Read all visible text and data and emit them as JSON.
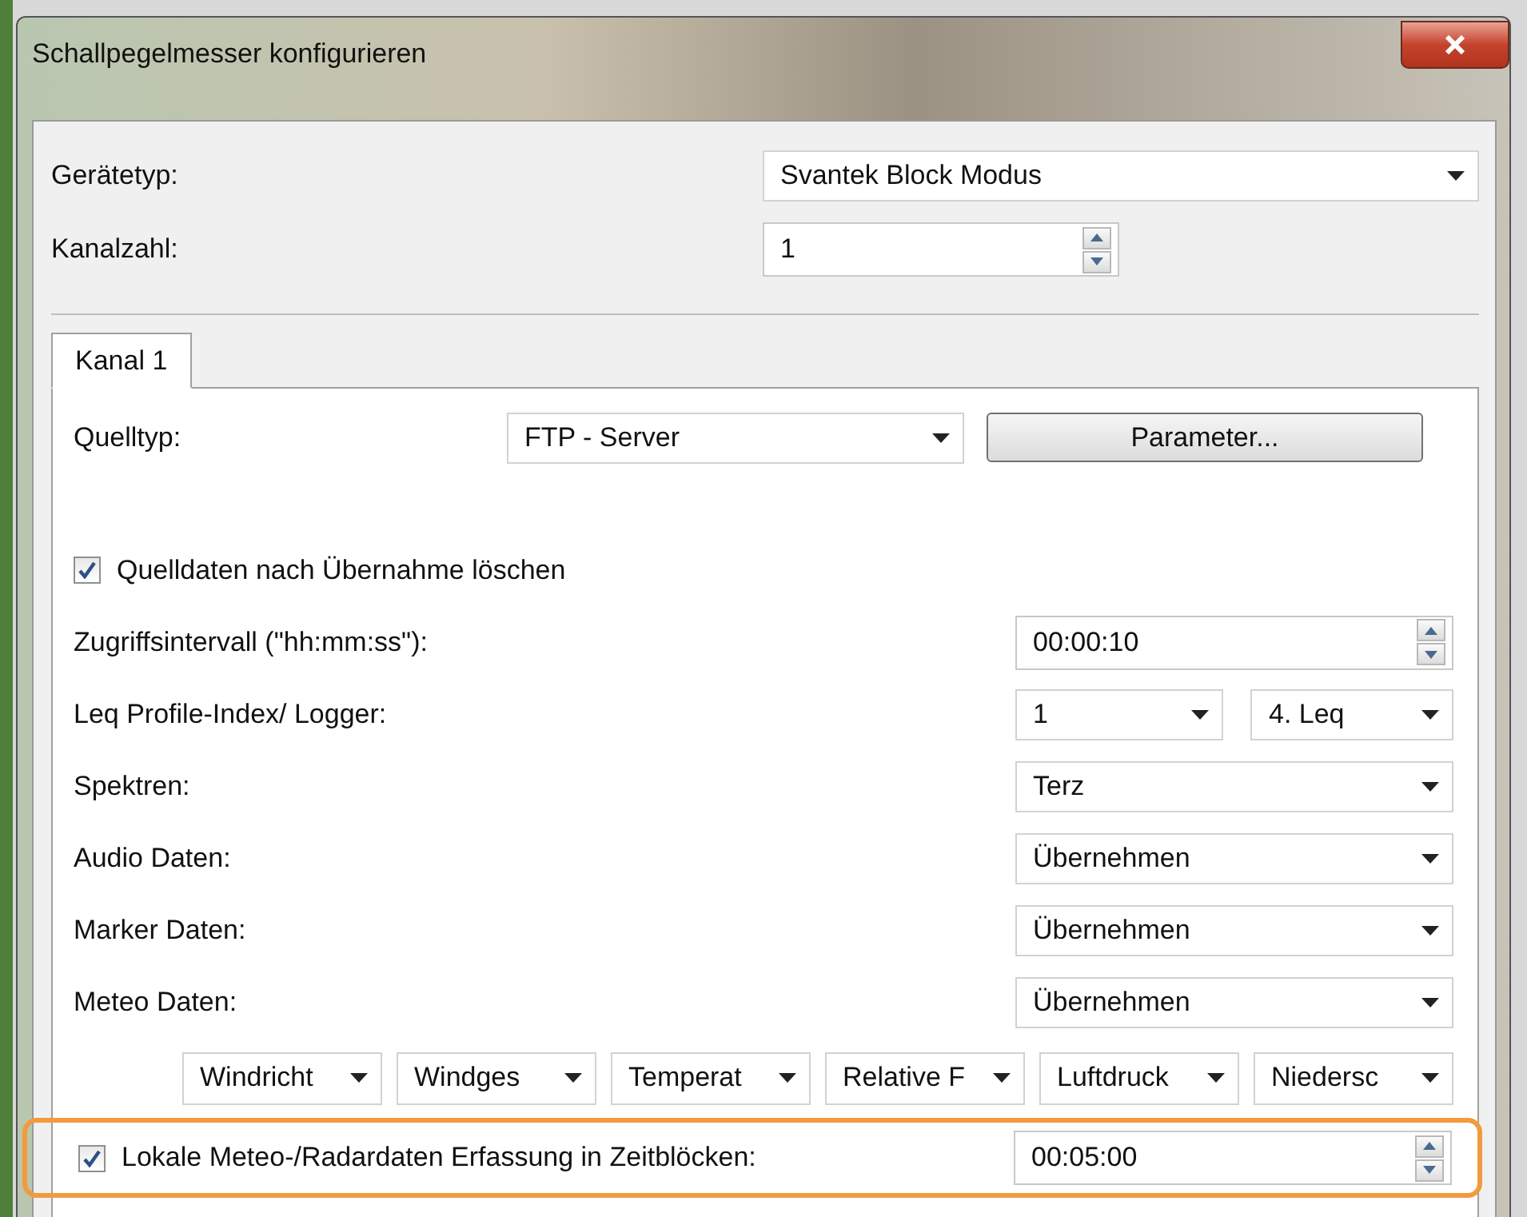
{
  "window": {
    "title": "Schallpegelmesser konfigurieren"
  },
  "device_type": {
    "label": "Gerätetyp:",
    "value": "Svantek Block Modus"
  },
  "channel_count": {
    "label": "Kanalzahl:",
    "value": "1"
  },
  "tabs": [
    {
      "label": "Kanal 1",
      "selected": true
    }
  ],
  "source_type": {
    "label": "Quelltyp:",
    "value": "FTP - Server",
    "button": "Parameter..."
  },
  "delete_source": {
    "label": "Quelldaten nach Übernahme löschen",
    "checked": true
  },
  "rows": [
    {
      "kind": "spinner",
      "label": "Zugriffsintervall (\"hh:mm:ss\"):",
      "values": [
        "00:00:10"
      ]
    },
    {
      "kind": "select",
      "label": "Leq Profile-Index/ Logger:",
      "values": [
        "1",
        "4. Leq"
      ]
    },
    {
      "kind": "select",
      "label": "Spektren:",
      "values": [
        "Terz"
      ]
    },
    {
      "kind": "select",
      "label": "Audio Daten:",
      "values": [
        "Übernehmen"
      ]
    },
    {
      "kind": "select",
      "label": "Marker Daten:",
      "values": [
        "Übernehmen"
      ]
    },
    {
      "kind": "select",
      "label": "Meteo Daten:",
      "values": [
        "Übernehmen"
      ]
    }
  ],
  "meteo_channels": [
    "Windricht",
    "Windges",
    "Temperat",
    "Relative F",
    "Luftdruck",
    "Niedersc"
  ],
  "local_meteo": {
    "label": "Lokale Meteo-/Radardaten Erfassung in Zeitblöcken:",
    "checked": true,
    "value": "00:05:00",
    "highlighted": true
  }
}
